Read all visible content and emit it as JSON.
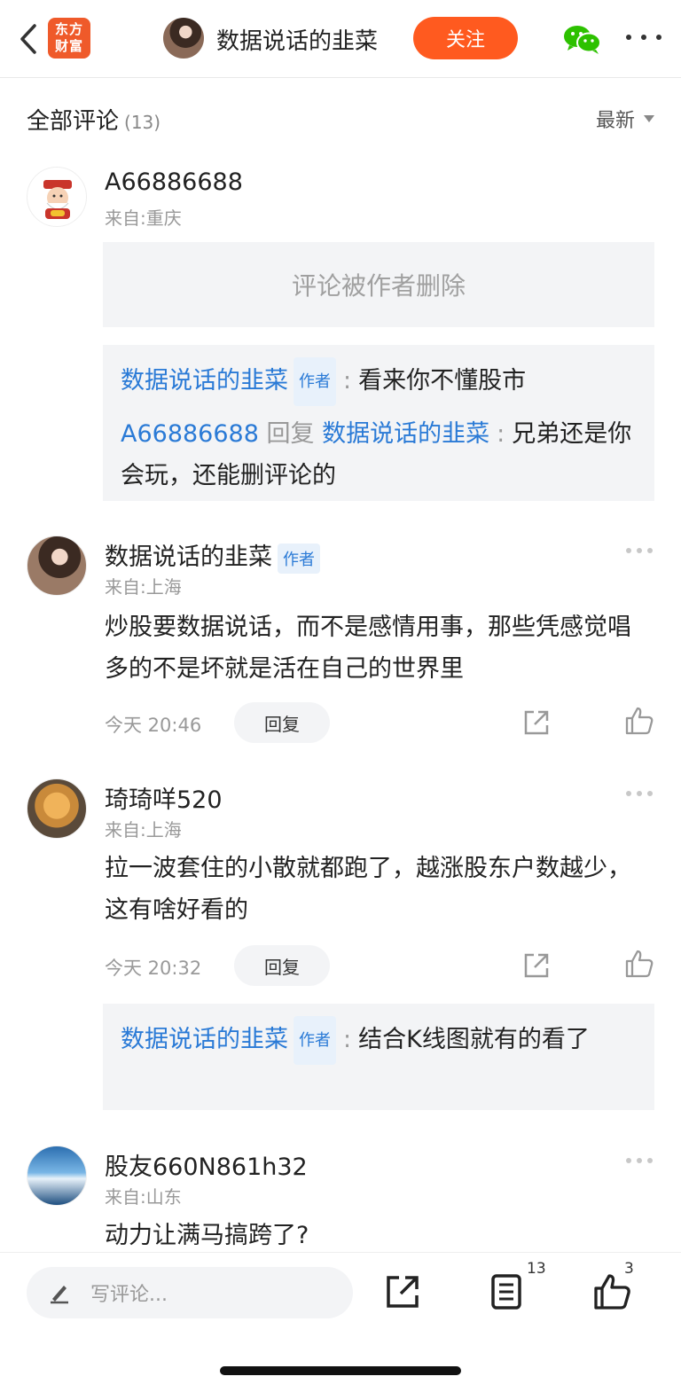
{
  "topbar": {
    "logo_line1": "东方",
    "logo_line2": "财富",
    "author_name": "数据说话的韭菜",
    "follow_label": "关注",
    "share_icon": "wechat-icon",
    "more_icon": "more-icon"
  },
  "header": {
    "title": "全部评论",
    "count": "(13)",
    "sort_label": "最新"
  },
  "comments": [
    {
      "name": "A66886688",
      "location": "来自:重庆",
      "deleted_text": "评论被作者删除",
      "replies": [
        {
          "from": "数据说话的韭菜",
          "tag": "作者",
          "text": "看来你不懂股市"
        },
        {
          "from": "A66886688",
          "reply_word": "回复",
          "to": "数据说话的韭菜",
          "text": "兄弟还是你会玩，还能删评论的"
        }
      ]
    },
    {
      "name": "数据说话的韭菜",
      "tag": "作者",
      "location": "来自:上海",
      "text": "炒股要数据说话，而不是感情用事，那些凭感觉唱多的不是坏就是活在自己的世界里",
      "time": "今天 20:46",
      "reply_label": "回复"
    },
    {
      "name": "琦琦咩520",
      "location": "来自:上海",
      "text": "拉一波套住的小散就都跑了，越涨股东户数越少，这有啥好看的",
      "time": "今天 20:32",
      "reply_label": "回复",
      "replies": [
        {
          "from": "数据说话的韭菜",
          "tag": "作者",
          "text": "结合K线图就有的看了"
        }
      ]
    },
    {
      "name": "股友660N861h32",
      "location": "来自:山东",
      "text": "动力让满马搞跨了?"
    }
  ],
  "bottombar": {
    "write_placeholder": "写评论...",
    "comment_count": "13",
    "like_count": "3"
  },
  "colors": {
    "accent": "#ff5a1f",
    "link": "#2a7ad6",
    "reply_bg": "#f3f4f6"
  }
}
